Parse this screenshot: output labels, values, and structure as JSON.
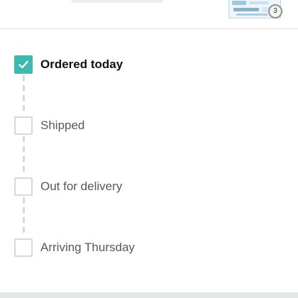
{
  "header": {
    "item_quantity": "3"
  },
  "tracker": {
    "steps": [
      {
        "label": "Ordered today",
        "completed": true
      },
      {
        "label": "Shipped",
        "completed": false
      },
      {
        "label": "Out for delivery",
        "completed": false
      },
      {
        "label": "Arriving Thursday",
        "completed": false
      }
    ]
  },
  "colors": {
    "completed": "#3fb8af",
    "pending_border": "#d5d9d9",
    "active_text": "#0f1111",
    "pending_text": "#565959"
  }
}
